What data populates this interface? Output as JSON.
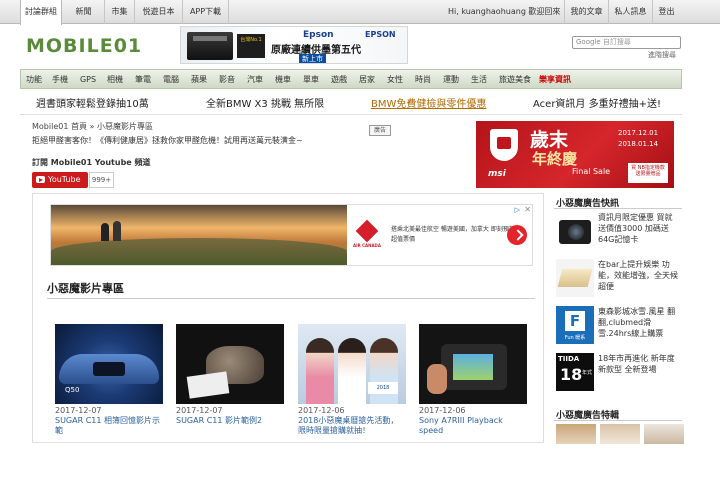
{
  "topbar": {
    "tabs": [
      "討論群組",
      "新聞",
      "市集",
      "悦遊日本",
      "APP下載"
    ],
    "user_greeting": "Hi, kuanghaohuang 歡迎回來",
    "links": [
      "我的文章",
      "私人訊息",
      "登出"
    ]
  },
  "header": {
    "logo_text": "MOBILE01",
    "ad": {
      "brand": "Epson",
      "brand2": "EPSON",
      "badge": "台灣No.1",
      "tagline": "原廠連續供墨第五代",
      "cta": "新上市"
    },
    "search": {
      "prefix": "Google",
      "placeholder": "自訂搜尋"
    },
    "advanced_search": "進階搜尋"
  },
  "nav": {
    "items": [
      "功能",
      "手機",
      "GPS",
      "相機",
      "筆電",
      "電腦",
      "蘋果",
      "影音",
      "汽車",
      "機車",
      "單車",
      "遊戲",
      "居家",
      "女性",
      "時尚",
      "運動",
      "生活",
      "旅遊美食",
      "樂享資訊"
    ]
  },
  "promos": [
    "週書頭家輕鬆登錄抽10萬",
    "全新BMW X3 挑戰 無所限",
    "BMW免費健檢與零件優惠",
    "Acer資訊月 多重好禮抽+送!"
  ],
  "breadcrumb": "Mobile01 首頁 » 小惡魔影片專區",
  "description": "拒絕甲醛害客你！《傳利健康居》拯救你家甲醛危機！試用再送萬元裝潢金~",
  "ad_label": "廣告",
  "youtube": {
    "heading": "訂閱 Mobile01 Youtube 頻道",
    "button": "YouTube",
    "count": "999+"
  },
  "msi_banner": {
    "logo": "msi",
    "line1": "歲末",
    "line2": "年終慶",
    "subtitle": "Final Sale",
    "date1": "2017.12.01",
    "date2": "2018.01.14",
    "tag": "買 NB指定機款送限量贈品"
  },
  "google_ad": {
    "brand": "AIR CANADA",
    "copy": "搭乘北美最佳航空 暢遊美國，加拿大 即刻預訂超值票價",
    "adchoices": "▷",
    "close": "✕"
  },
  "videos": {
    "heading": "小惡魔影片專區",
    "items": [
      {
        "date": "2017-12-07",
        "title": "SUGAR C11 相簿回憶影片示範",
        "overlay": "Q50"
      },
      {
        "date": "2017-12-07",
        "title": "SUGAR C11 影片範例2"
      },
      {
        "date": "2017-12-06",
        "title": "2018小惡魔桌曆搶先活動，限時限量搶購就抽！",
        "overlay": "2018"
      },
      {
        "date": "2017-12-06",
        "title": "Sony A7RIII Playback speed"
      }
    ]
  },
  "sidebar": {
    "news_heading": "小惡魔廣告快訊",
    "news": [
      "資訊月限定優惠 買就送價值3000 加碼送64G記憶卡",
      "在bar上提升娛樂 功能，效能增強，全天候超便",
      "東森影城冰雪.風星 翻翻,clubmed滑 雪.24hrs線上購票",
      "18年市再進化 新年度新款型 全新登場"
    ],
    "icon_texts": {
      "fun": "F",
      "fun_sub": "Fun 暖系",
      "tiida_top": "TIIDA",
      "tiida_num": "18",
      "tiida_sub": "年式"
    },
    "special_heading": "小惡魔廣告特輯"
  },
  "colors": {
    "nav_bg": "#d6e0cc",
    "accent_red": "#cc1b1b",
    "link_blue": "#2b5f9e"
  }
}
